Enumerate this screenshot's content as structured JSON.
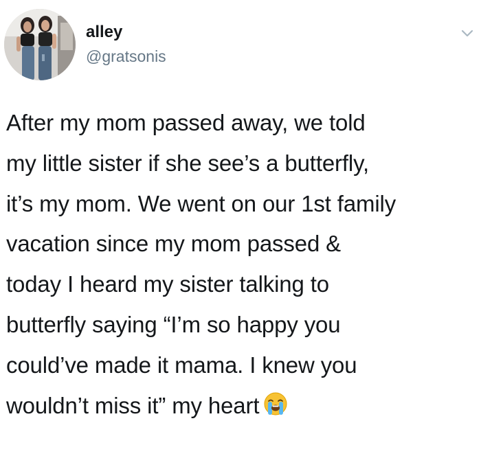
{
  "tweet": {
    "display_name": "alley",
    "handle": "@gratsonis",
    "text": "After my mom passed away, we told\nmy little sister if she see’s a butterfly,\nit’s my mom. We went on our 1st family\nvacation since my mom passed &\ntoday I heard my sister talking to\nbutterfly saying “I’m so happy you\ncould’ve made it mama. I knew you\nwouldn’t miss it” my heart",
    "emoji": "loudly-crying-face-icon",
    "menu_icon": "chevron-down-icon",
    "colors": {
      "text": "#14171a",
      "handle": "#657786",
      "background": "#ffffff"
    }
  }
}
